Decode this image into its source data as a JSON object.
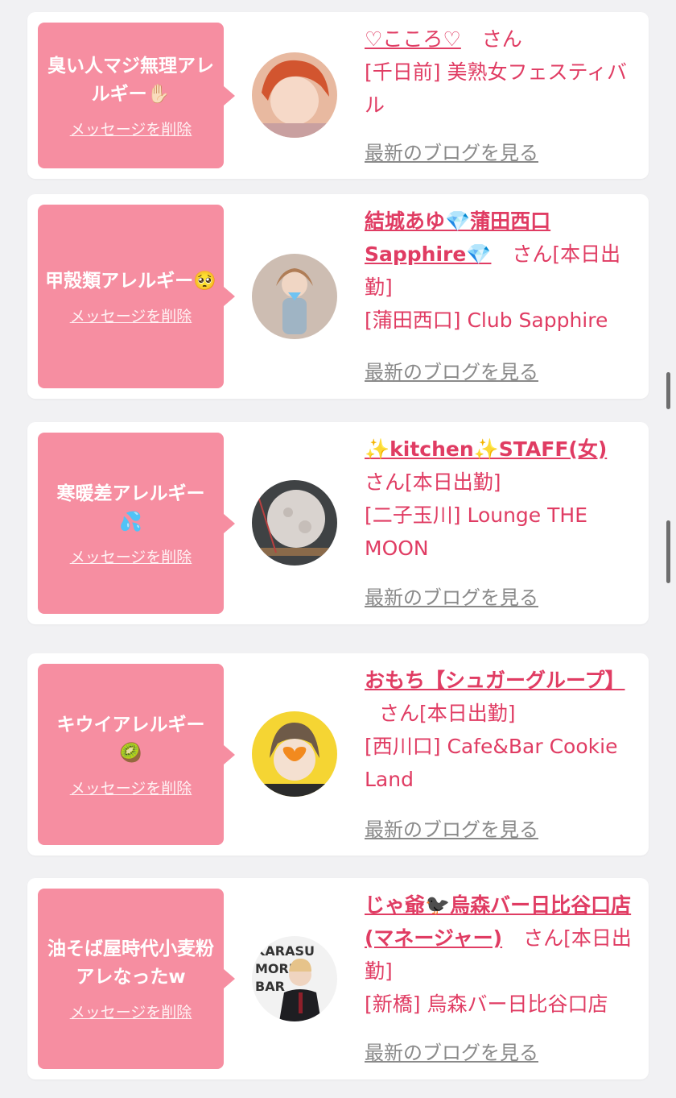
{
  "cards": [
    {
      "message": "臭い人マジ無理アレルギー✋🏻",
      "delete_label": "メッセージを削除",
      "name": "♡こころ♡",
      "san": "さん",
      "shop": "[千日前] 美熟女フェスティバル",
      "blog_label": "最新のブログを見る"
    },
    {
      "message": "甲殻類アレルギー🥺",
      "delete_label": "メッセージを削除",
      "name": "結城あゆ💎蒲田西口Sapphire💎",
      "san": "さん[本日出勤]",
      "shop": "[蒲田西口] Club Sapphire",
      "blog_label": "最新のブログを見る"
    },
    {
      "message": "寒暖差アレルギー💦",
      "delete_label": "メッセージを削除",
      "name": "✨kitchen✨STAFF(女)",
      "san": "さん[本日出勤]",
      "shop": "[二子玉川] Lounge THE MOON",
      "blog_label": "最新のブログを見る"
    },
    {
      "message": "キウイアレルギー🥝",
      "delete_label": "メッセージを削除",
      "name": "おもち【シュガーグループ】",
      "san": "さん[本日出勤]",
      "shop": "[西川口] Cafe&Bar Cookie Land",
      "blog_label": "最新のブログを見る"
    },
    {
      "message": "油そば屋時代小麦粉アレなったw",
      "delete_label": "メッセージを削除",
      "name": "じゃ爺🐦‍⬛烏森バー日比谷口店(マネージャー)",
      "san": "さん[本日出勤]",
      "shop": "[新橋] 烏森バー日比谷口店",
      "blog_label": "最新のブログを見る"
    }
  ],
  "colors": {
    "bubble": "#f68ea1",
    "accent": "#e03c63",
    "link_gray": "#8a8a8a",
    "background": "#f1f1f3"
  }
}
